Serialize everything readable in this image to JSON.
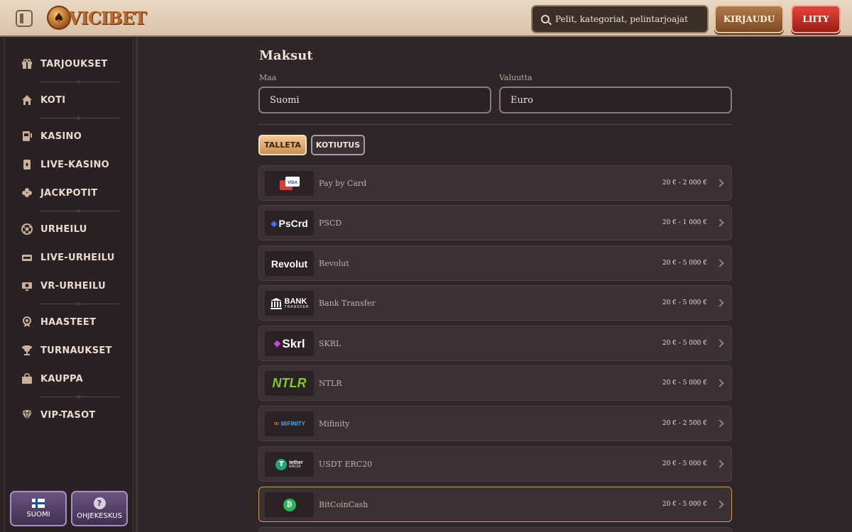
{
  "header": {
    "logo_text": "VICIBET",
    "search_placeholder": "Pelit, kategoriat, pelintarjoajat",
    "login_label": "KIRJAUDU",
    "join_label": "LIITY"
  },
  "sidebar": {
    "items": [
      {
        "label": "TARJOUKSET",
        "icon": "gift-icon"
      },
      {
        "label": "KOTI",
        "icon": "home-icon"
      },
      {
        "label": "KASINO",
        "icon": "slot-machine-icon"
      },
      {
        "label": "LIVE-KASINO",
        "icon": "cards-icon"
      },
      {
        "label": "JACKPOTIT",
        "icon": "clover-icon"
      },
      {
        "label": "URHEILU",
        "icon": "football-icon"
      },
      {
        "label": "LIVE-URHEILU",
        "icon": "live-icon"
      },
      {
        "label": "VR-URHEILU",
        "icon": "vr-monitor-icon"
      },
      {
        "label": "HAASTEET",
        "icon": "challenge-icon"
      },
      {
        "label": "TURNAUKSET",
        "icon": "trophy-icon"
      },
      {
        "label": "KAUPPA",
        "icon": "shop-bag-icon"
      },
      {
        "label": "VIP-TASOT",
        "icon": "diamond-icon"
      }
    ],
    "language_label": "SUOMI",
    "help_label": "OHJEKESKUS",
    "help_glyph": "?"
  },
  "main": {
    "title": "Maksut",
    "country_label": "Maa",
    "country_value": "Suomi",
    "currency_label": "Valuutta",
    "currency_value": "Euro",
    "tabs": [
      {
        "label": "TALLETA",
        "active": true
      },
      {
        "label": "KOTIUTUS",
        "active": false
      }
    ],
    "methods": [
      {
        "name": "Pay by Card",
        "range": "20 € - 2 000 €",
        "logo": "VISA"
      },
      {
        "name": "PSCD",
        "range": "20 € - 1 000 €",
        "logo": "PsCrd"
      },
      {
        "name": "Revolut",
        "range": "20 € - 5 000 €",
        "logo": "Revolut"
      },
      {
        "name": "Bank Transfer",
        "range": "20 € - 5 000 €",
        "logo": "BANK",
        "logo_sub": "TRANSFER"
      },
      {
        "name": "SKRL",
        "range": "20 € - 5 000 €",
        "logo": "Skrl"
      },
      {
        "name": "NTLR",
        "range": "20 € - 5 000 €",
        "logo": "NTLR"
      },
      {
        "name": "Mifinity",
        "range": "20 € - 2 500 €",
        "logo": "MiFINITY"
      },
      {
        "name": "USDT ERC20",
        "range": "20 € - 5 000 €",
        "logo": "tether",
        "logo_sub": "ERC20"
      },
      {
        "name": "BitCoinCash",
        "range": "20 € - 5 000 €",
        "logo": "₿",
        "selected": true
      }
    ]
  },
  "colors": {
    "background": "#2f2629",
    "header": "#e2cdb6",
    "accent_gold": "#c99b54",
    "join_red": "#c8302a",
    "language_purple": "#5a4670"
  }
}
